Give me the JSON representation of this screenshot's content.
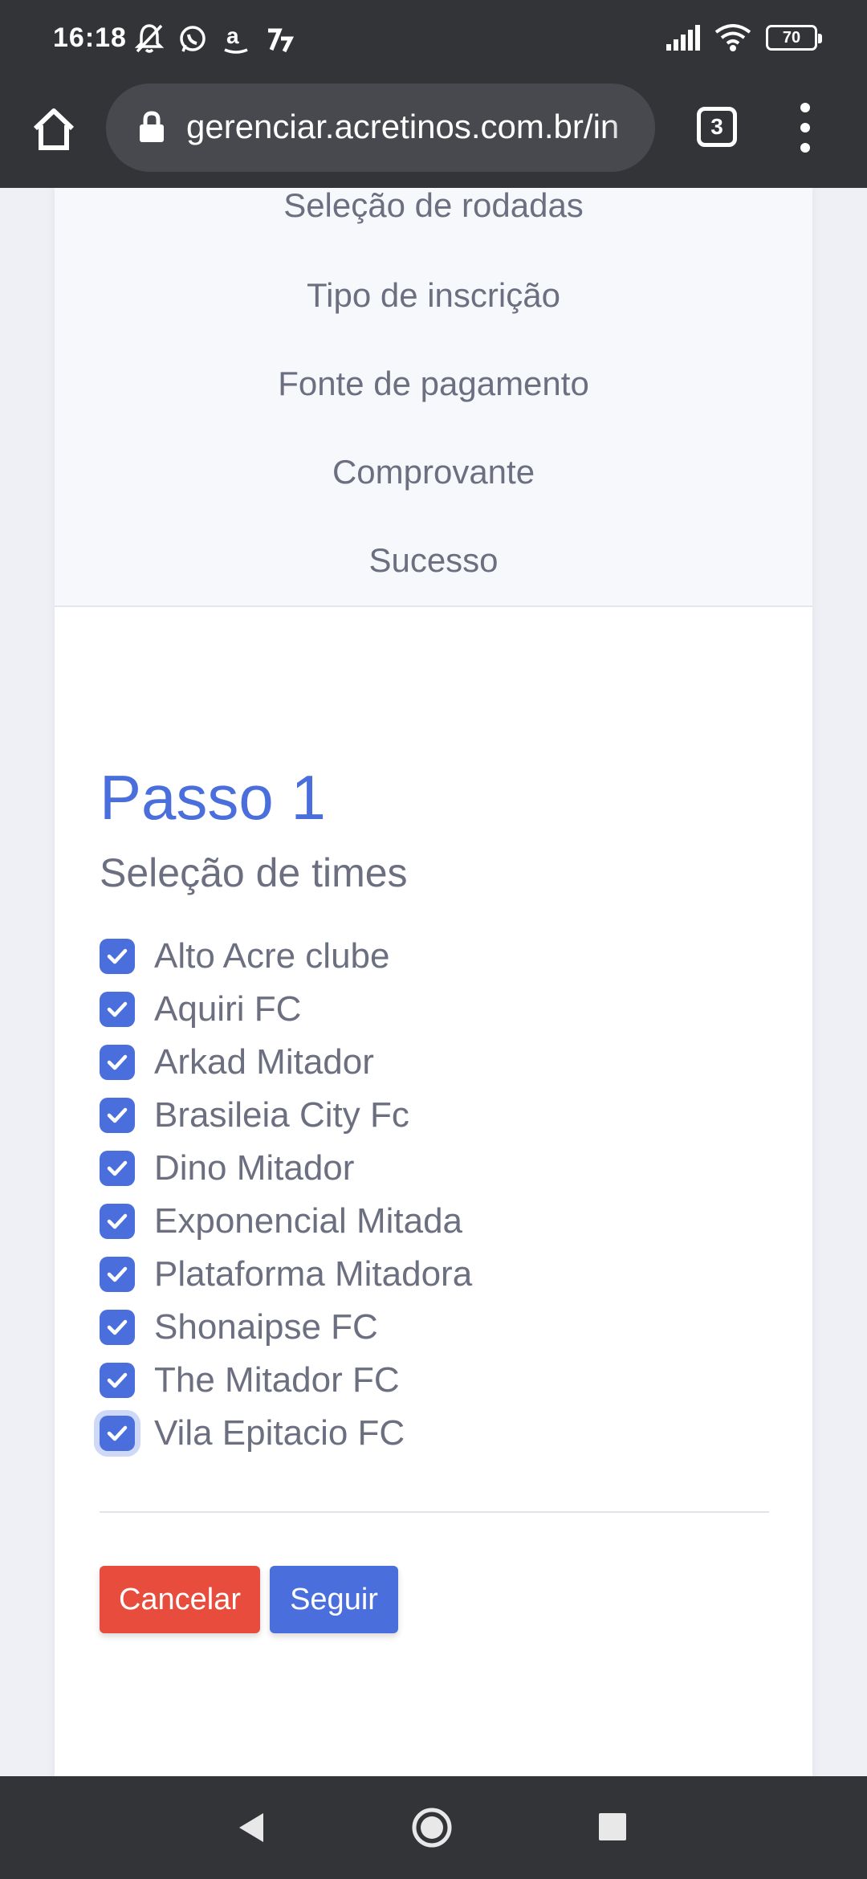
{
  "status_bar": {
    "time": "16:18",
    "battery": "70",
    "icons": [
      "mute-icon",
      "whatsapp-icon",
      "amazon-icon",
      "app-icon",
      "signal-icon",
      "wifi-icon",
      "battery-icon"
    ]
  },
  "browser": {
    "url": "gerenciar.acretinos.com.br/in",
    "tab_count": "3"
  },
  "steps_menu": {
    "items": [
      "Seleção de rodadas",
      "Tipo de inscrição",
      "Fonte de pagamento",
      "Comprovante",
      "Sucesso"
    ]
  },
  "form": {
    "title": "Passo 1",
    "subtitle": "Seleção de times",
    "teams": [
      {
        "label": "Alto Acre clube",
        "checked": true
      },
      {
        "label": "Aquiri FC",
        "checked": true
      },
      {
        "label": "Arkad Mitador",
        "checked": true
      },
      {
        "label": "Brasileia City Fc",
        "checked": true
      },
      {
        "label": "Dino Mitador",
        "checked": true
      },
      {
        "label": "Exponencial Mitada",
        "checked": true
      },
      {
        "label": "Plataforma Mitadora",
        "checked": true
      },
      {
        "label": "Shonaipse FC",
        "checked": true
      },
      {
        "label": "The Mitador FC",
        "checked": true
      },
      {
        "label": "Vila Epitacio FC",
        "checked": true
      }
    ],
    "cancel_label": "Cancelar",
    "next_label": "Seguir"
  },
  "colors": {
    "primary": "#4a6fdc",
    "danger": "#e74c3c",
    "chrome": "#323438"
  }
}
